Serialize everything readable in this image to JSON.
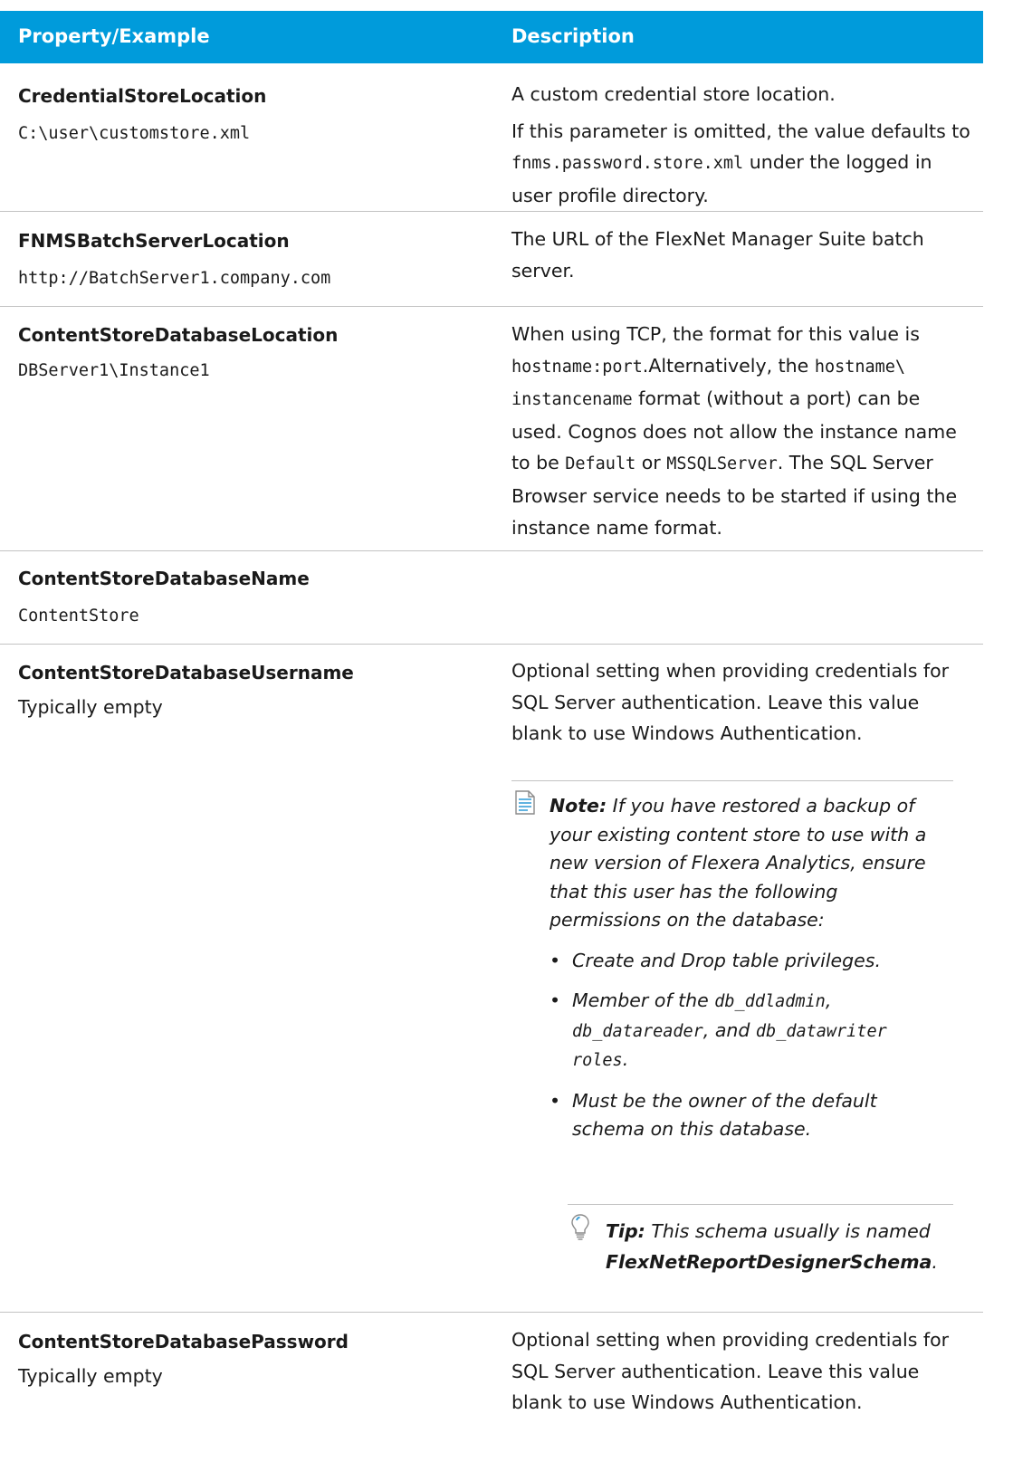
{
  "header": {
    "col1": "Property/Example",
    "col2": "Description"
  },
  "rows": [
    {
      "name": "CredentialStoreLocation",
      "example": "C:\\user\\customstore.xml",
      "desc1": "A custom credential store location.",
      "desc2a": "If this parameter is omitted, the value defaults to ",
      "desc2code": "fnms.password.store.xml",
      "desc2b": " under the logged in user profile directory."
    },
    {
      "name": "FNMSBatchServerLocation",
      "example": "http://BatchServer1.company.com",
      "desc": "The URL of the FlexNet Manager Suite batch server."
    },
    {
      "name": "ContentStoreDatabaseLocation",
      "example": "DBServer1\\Instance1",
      "d_a": "When using TCP, the format for this value is ",
      "d_code1": "hostname:port",
      "d_b": ".Alternatively, the ",
      "d_code2": "hostname\\ instancename",
      "d_c": " format (without a port) can be used. Cognos does not allow the instance name to be ",
      "d_code3": "Default",
      "d_d": " or ",
      "d_code4": "MSSQLServer",
      "d_e": ". The SQL Server Browser service needs to be started if using the instance name format."
    },
    {
      "name": "ContentStoreDatabaseName",
      "example": "ContentStore"
    },
    {
      "name": "ContentStoreDatabaseUsername",
      "example": "Typically empty",
      "desc": "Optional setting when providing credentials for SQL Server authentication. Leave this value blank to use Windows Authentication.",
      "note_label": "Note:",
      "note_text": " If you have restored a backup of your existing content store to use with a new version of Flexera Analytics, ensure that this user has the following permissions on the database:",
      "bullet1": "Create and Drop table privileges.",
      "bullet2_a": "Member of the ",
      "bullet2_c1": "db_ddladmin",
      "bullet2_b": ", ",
      "bullet2_c2": "db_datareader",
      "bullet2_c": ", and ",
      "bullet2_c3": "db_datawriter roles",
      "bullet2_d": ".",
      "bullet3": "Must be the owner of the default schema on this database.",
      "tip_label": "Tip:",
      "tip_text": " This schema usually is named ",
      "tip_bold": "FlexNetReportDesignerSchema",
      "tip_end": "."
    },
    {
      "name": "ContentStoreDatabasePassword",
      "example": "Typically empty",
      "desc": "Optional setting when providing credentials for SQL Server authentication. Leave this value blank to use Windows Authentication."
    }
  ],
  "colors": {
    "header_bg": "#009bdb",
    "rule": "#c3c3c3"
  },
  "icons": {
    "note": "note-icon",
    "tip": "lightbulb-icon"
  }
}
